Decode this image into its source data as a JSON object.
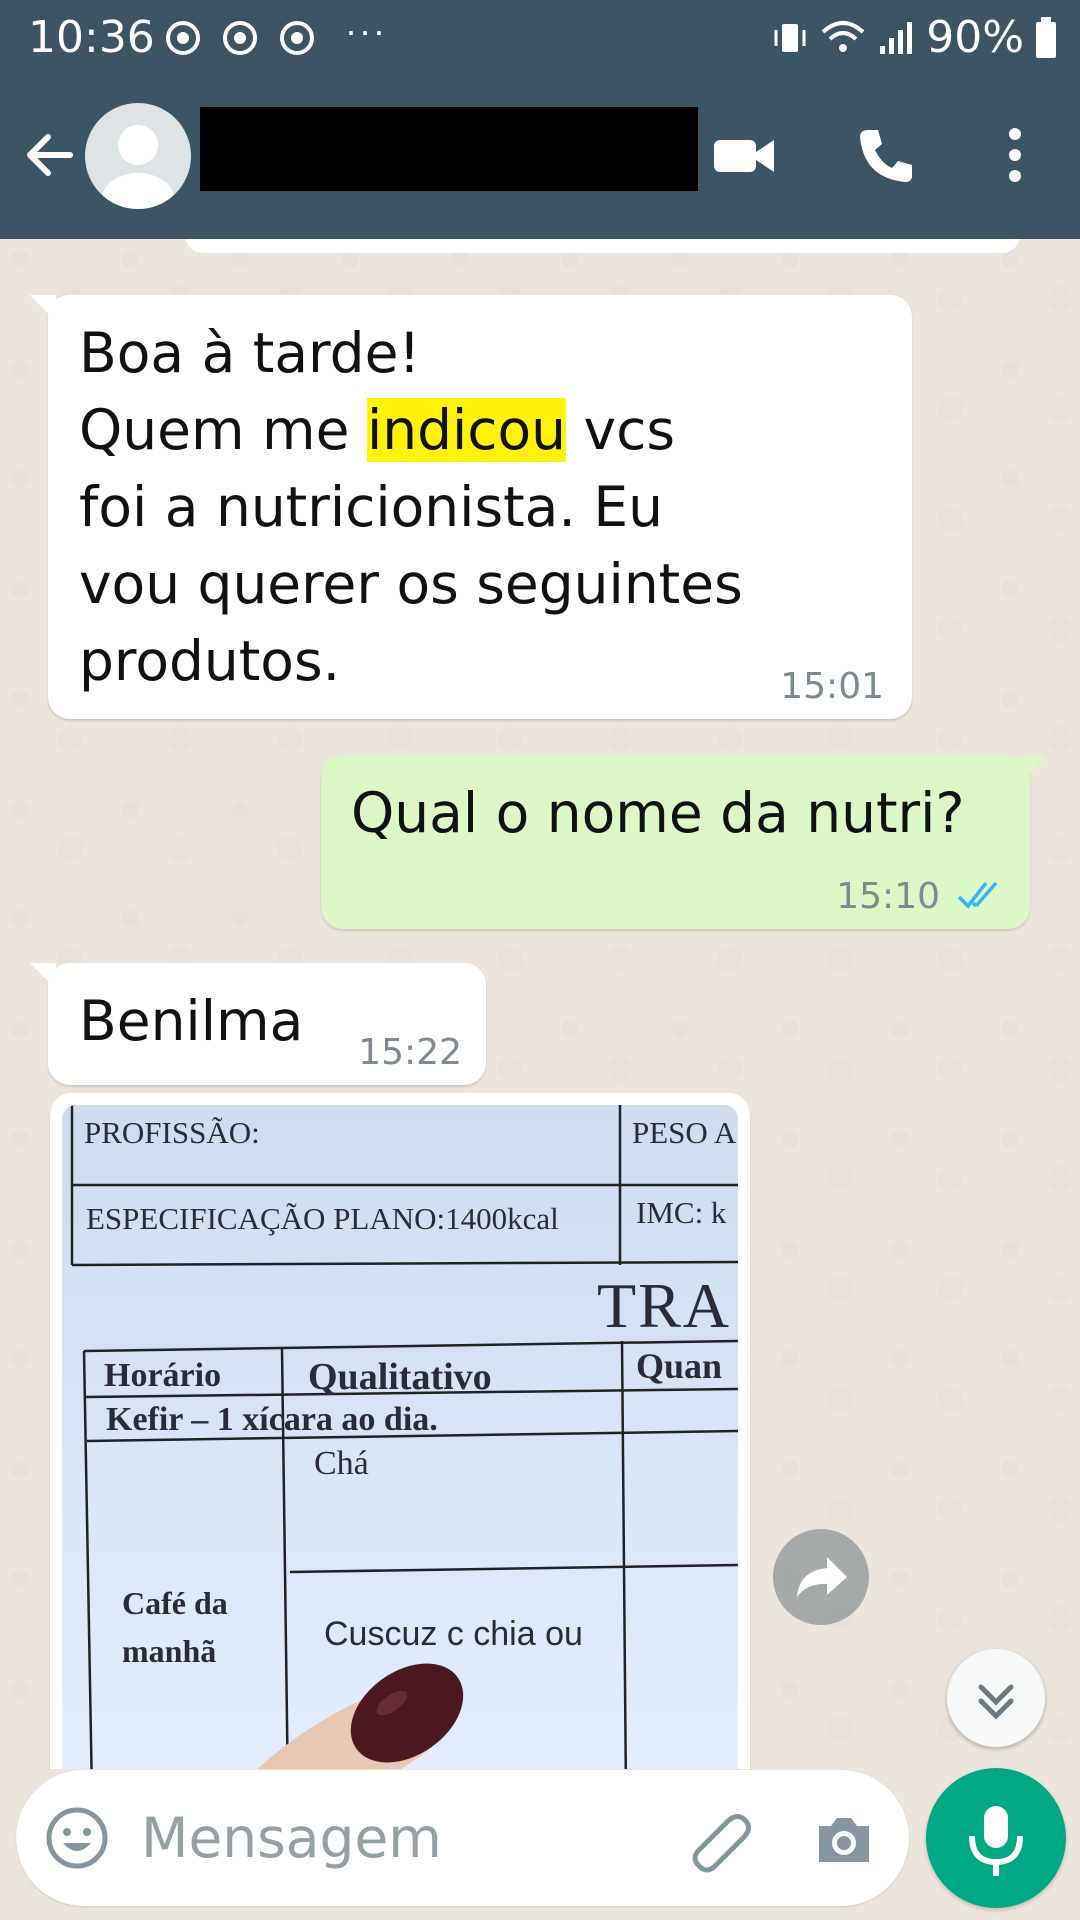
{
  "status_bar": {
    "time": "10:36",
    "dots": "···",
    "battery": "90%"
  },
  "header": {
    "contact_name": ""
  },
  "messages": [
    {
      "direction": "incoming",
      "line1": "Boa à tarde!",
      "line2_before": "Quem me ",
      "line2_highlight": "indicou",
      "line2_after": " vcs",
      "line3": "foi a nutricionista. Eu",
      "line4": "vou querer os seguintes",
      "line5": "produtos.",
      "time": "15:01"
    },
    {
      "direction": "outgoing",
      "text": "Qual o nome da nutri?",
      "time": "15:10"
    },
    {
      "direction": "incoming",
      "text": "Benilma",
      "time": "15:22"
    }
  ],
  "photo": {
    "profissao": "PROFISSÃO:",
    "peso": "PESO A",
    "especificacao": "ESPECIFICAÇÃO PLANO:1400kcal",
    "imc": "IMC:  k",
    "tra": "TRA",
    "horario": "Horário",
    "qualitativo": "Qualitativo",
    "quan": "Quan",
    "kefir": "Kefir – 1 xícara ao dia.",
    "cha": "Chá",
    "cafe1": "Café da",
    "cafe2": "manhã",
    "cuscuz": "Cuscuz c chia ou"
  },
  "composer": {
    "placeholder": "Mensagem"
  },
  "colors": {
    "header": "#3C5565",
    "chat_bg": "#ECE5DD",
    "outgoing_bubble": "#DCF8C6",
    "incoming_bubble": "#FFFFFF",
    "highlight": "#FFF20A",
    "mic_button": "#00A884",
    "read_ticks": "#34B7F1"
  },
  "icons": [
    "back-arrow-icon",
    "avatar-icon",
    "video-call-icon",
    "phone-icon",
    "more-vert-icon",
    "chrome-icon",
    "vibrate-icon",
    "wifi-icon",
    "signal-icon",
    "battery-icon",
    "double-check-icon",
    "share-icon",
    "chevron-double-down-icon",
    "emoji-icon",
    "attach-icon",
    "camera-icon",
    "mic-icon"
  ]
}
